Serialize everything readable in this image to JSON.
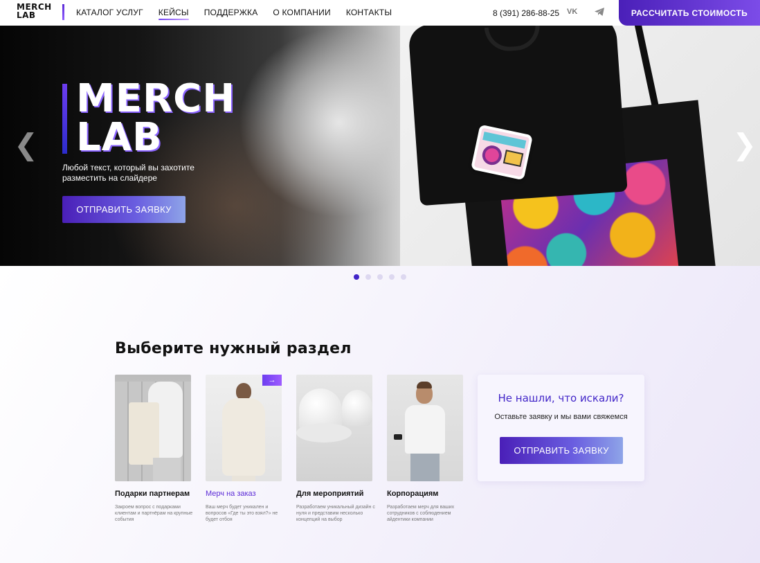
{
  "header": {
    "logo_line1": "MERCH",
    "logo_line2": "LAB",
    "nav": [
      "КАТАЛОГ УСЛУГ",
      "КЕЙСЫ",
      "ПОДДЕРЖКА",
      "О КОМПАНИИ",
      "КОНТАКТЫ"
    ],
    "active_nav": "КЕЙСЫ",
    "phone": "8 (391) 286-88-25",
    "vk_label": "VK",
    "cta_label": "РАССЧИТАТЬ СТОИМОСТЬ"
  },
  "hero": {
    "title_line1": "MERCH",
    "title_line2": "LAB",
    "subtitle": "Любой текст, который вы захотите разместить на слайдере",
    "button_label": "ОТПРАВИТЬ ЗАЯВКУ",
    "prev_icon": "chevron-left-icon",
    "next_icon": "chevron-right-icon",
    "slides_count": 5,
    "active_slide": 1
  },
  "section": {
    "title": "Выберите нужный раздел",
    "cards": [
      {
        "name": "Подарки партнерам",
        "desc": "Закроем вопрос с подарками клиентам и партнёрам на крупные события"
      },
      {
        "name": "Мерч на заказ",
        "desc": "Ваш мерч будет уникален и вопросов «Где ты это взял?» не будет отбоя"
      },
      {
        "name": "Для мероприятий",
        "desc": "Разработаем уникальный дизайн с нуля и представим несколько концепций на выбор"
      },
      {
        "name": "Корпорациям",
        "desc": "Разработаем мерч для ваших сотрудников с соблюдением айдентики компании"
      }
    ],
    "badge_icon": "arrow-right-icon",
    "cta": {
      "title": "Не нашли, что искали?",
      "text": "Оставьте заявку и мы вами свяжемся",
      "button_label": "ОТПРАВИТЬ ЗАЯВКУ"
    }
  },
  "colors": {
    "accent": "#4125c8",
    "accent_gradient_start": "#4a1fb8",
    "accent_gradient_end": "#8ea4e8"
  }
}
